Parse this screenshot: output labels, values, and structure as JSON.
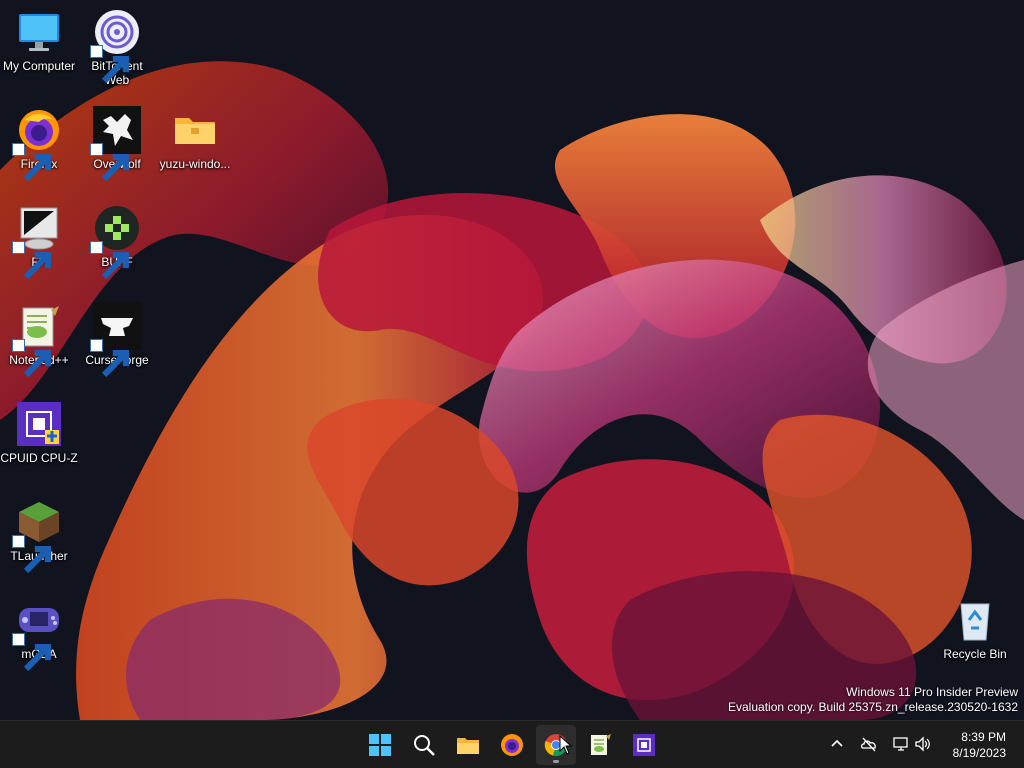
{
  "desktop": {
    "icons": [
      {
        "label_line1": "My Computer",
        "label_line2": ""
      },
      {
        "label_line1": "BitTorrent",
        "label_line2": "Web"
      },
      {
        "label_line1": "Firefox",
        "label_line2": ""
      },
      {
        "label_line1": "Overwolf",
        "label_line2": ""
      },
      {
        "label_line1": "yuzu-windo...",
        "label_line2": ""
      },
      {
        "label_line1": "FP",
        "label_line2": ""
      },
      {
        "label_line1": "BUFF",
        "label_line2": ""
      },
      {
        "label_line1": "Notepad++",
        "label_line2": ""
      },
      {
        "label_line1": "CurseForge",
        "label_line2": ""
      },
      {
        "label_line1": "CPUID CPU-Z",
        "label_line2": ""
      },
      {
        "label_line1": "TLauncher",
        "label_line2": ""
      },
      {
        "label_line1": "mGBA",
        "label_line2": ""
      },
      {
        "label_line1": "Recycle Bin",
        "label_line2": ""
      }
    ]
  },
  "watermark": {
    "line1": "Windows 11 Pro Insider Preview",
    "line2": "Evaluation copy. Build 25375.zn_release.230520-1632"
  },
  "taskbar": {
    "pinned": [
      "start-icon",
      "search-icon",
      "file-explorer-icon",
      "firefox-icon",
      "chrome-icon",
      "notepad-plus-plus-icon",
      "cpu-z-icon"
    ],
    "active": "chrome-icon"
  },
  "tray": {
    "icons": [
      "chevron-up-icon",
      "onedrive-icon",
      "network-icon",
      "volume-icon"
    ]
  },
  "clock": {
    "time": "8:39 PM",
    "date": "8/19/2023"
  },
  "colors": {
    "taskbar_bg": "#1c1c1c",
    "wallpaper_bg": "#0f1020",
    "accent": "#0078d4"
  }
}
